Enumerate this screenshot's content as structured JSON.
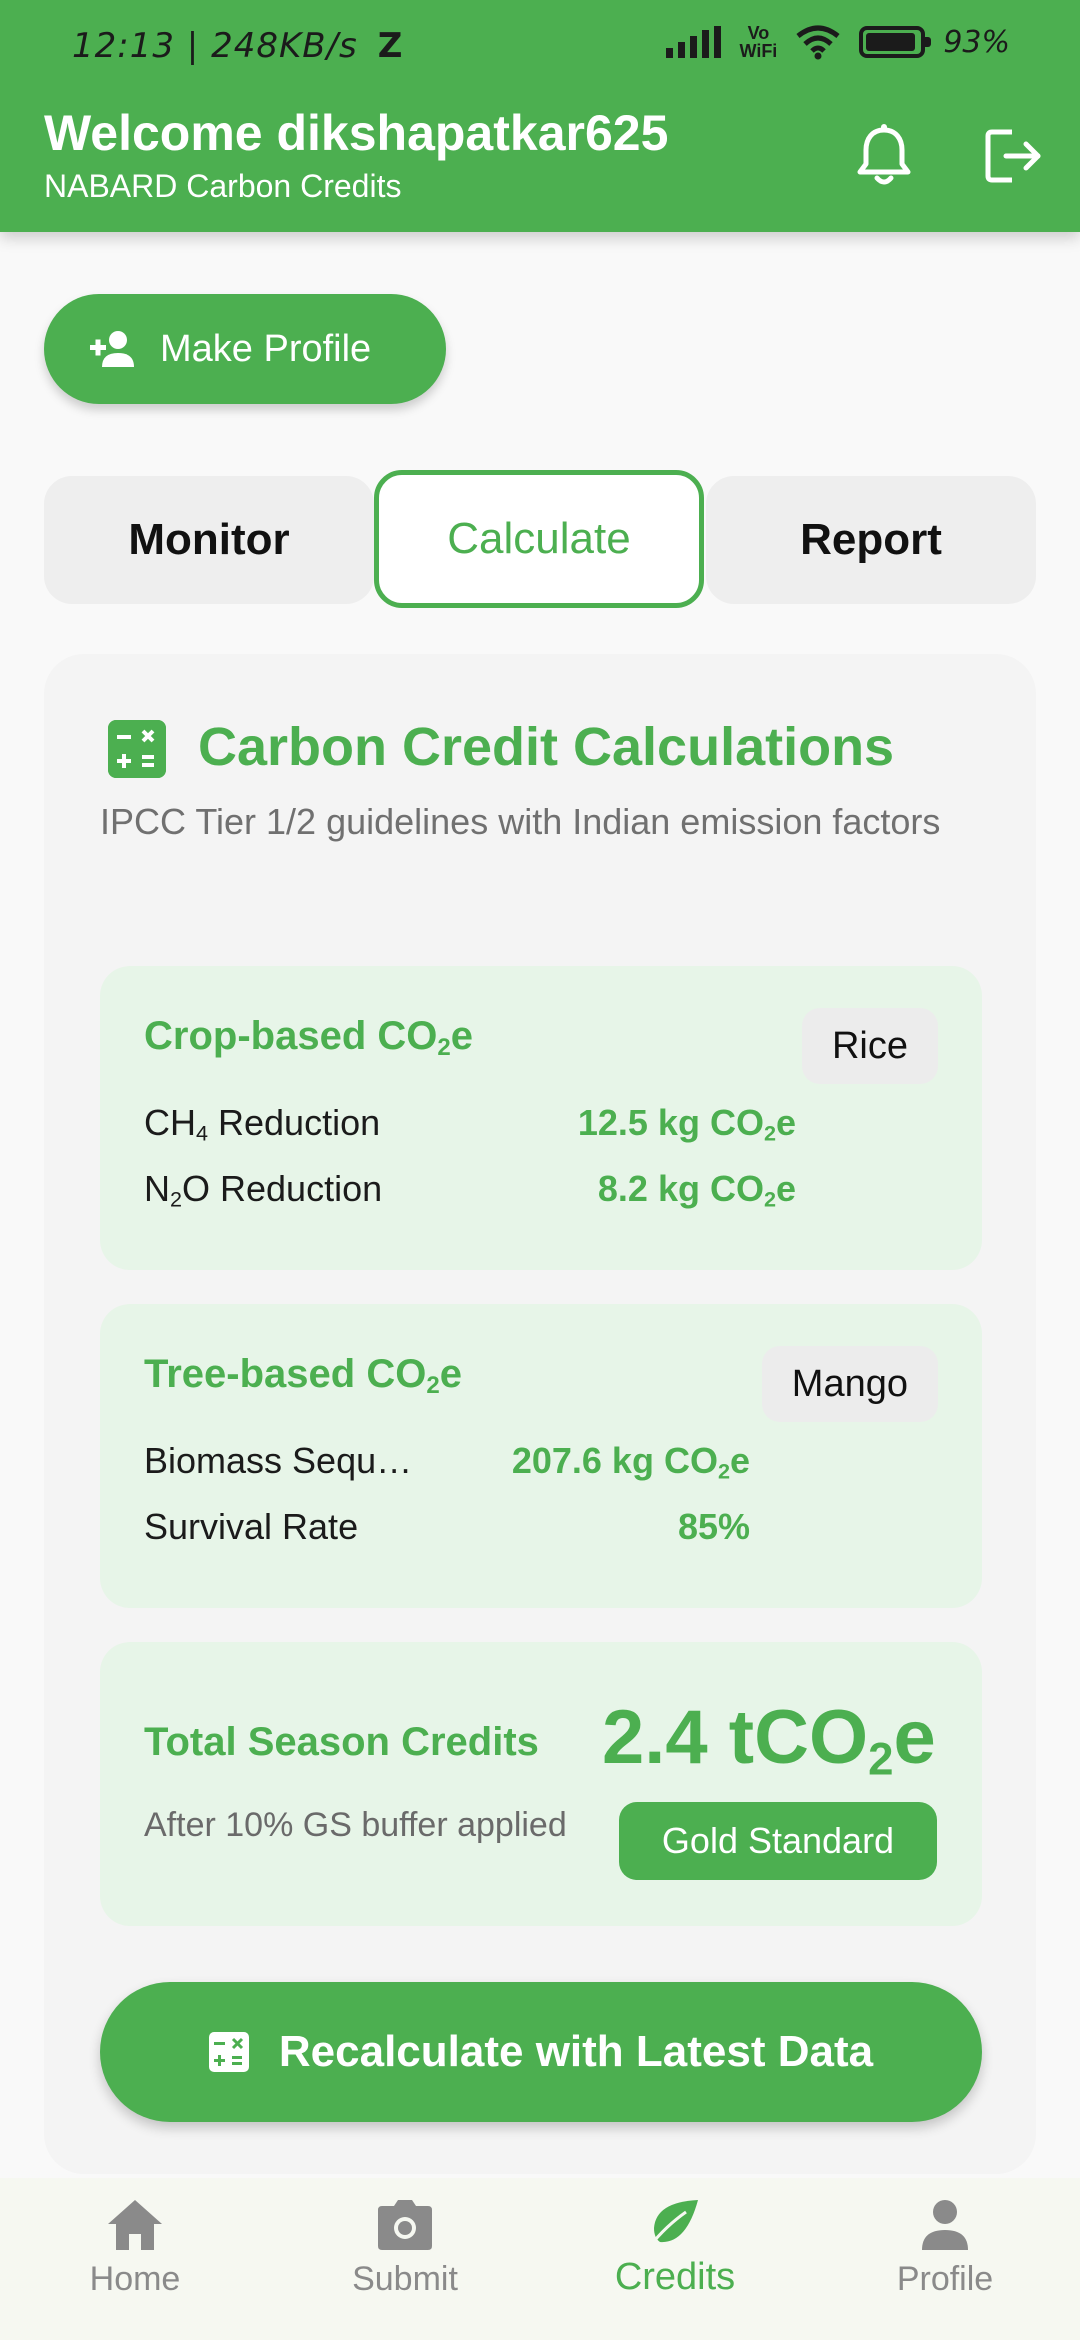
{
  "status_bar": {
    "time": "12:13",
    "network_speed": "248KB/s",
    "carrier_badge": "Z",
    "vowifi_top": "Vo",
    "vowifi_bottom": "WiFi",
    "battery": "93%"
  },
  "header": {
    "welcome": "Welcome dikshapatkar625",
    "subtitle": "NABARD Carbon Credits",
    "icons": [
      "bell-icon",
      "logout-icon"
    ]
  },
  "make_profile_label": "Make Profile",
  "tabs": [
    {
      "label": "Monitor",
      "active": false
    },
    {
      "label": "Calculate",
      "active": true
    },
    {
      "label": "Report",
      "active": false
    }
  ],
  "calculations": {
    "title": "Carbon Credit Calculations",
    "subtitle": "IPCC Tier 1/2 guidelines with Indian emission factors",
    "crop": {
      "title_prefix": "Crop-based CO",
      "title_sub": "2",
      "title_suffix": "e",
      "chip": "Rice",
      "rows": [
        {
          "label_pre": "CH",
          "label_sub": "4",
          "label_post": " Reduction",
          "value_pre": "12.5 kg CO",
          "value_sub": "2",
          "value_post": "e"
        },
        {
          "label_pre": "N",
          "label_sub": "2",
          "label_post": "O Reduction",
          "value_pre": "8.2 kg CO",
          "value_sub": "2",
          "value_post": "e"
        }
      ]
    },
    "tree": {
      "title_prefix": "Tree-based CO",
      "title_sub": "2",
      "title_suffix": "e",
      "chip": "Mango",
      "rows": [
        {
          "label": "Biomass Sequ…",
          "value_pre": "207.6 kg CO",
          "value_sub": "2",
          "value_post": "e"
        },
        {
          "label": "Survival Rate",
          "value": "85%"
        }
      ]
    },
    "total": {
      "title": "Total Season Credits",
      "value_pre": "2.4 tCO",
      "value_sub": "2",
      "value_post": "e",
      "note": "After 10% GS buffer applied",
      "badge": "Gold Standard"
    },
    "recalc_label": "Recalculate with Latest Data"
  },
  "bottom_nav": [
    {
      "label": "Home",
      "icon": "home-icon",
      "active": false
    },
    {
      "label": "Submit",
      "icon": "camera-icon",
      "active": false
    },
    {
      "label": "Credits",
      "icon": "leaf-icon",
      "active": true
    },
    {
      "label": "Profile",
      "icon": "person-icon",
      "active": false
    }
  ],
  "colors": {
    "primary": "#4caf50",
    "light_green": "#e7f5e8",
    "tab_inactive": "#eeeeee"
  }
}
